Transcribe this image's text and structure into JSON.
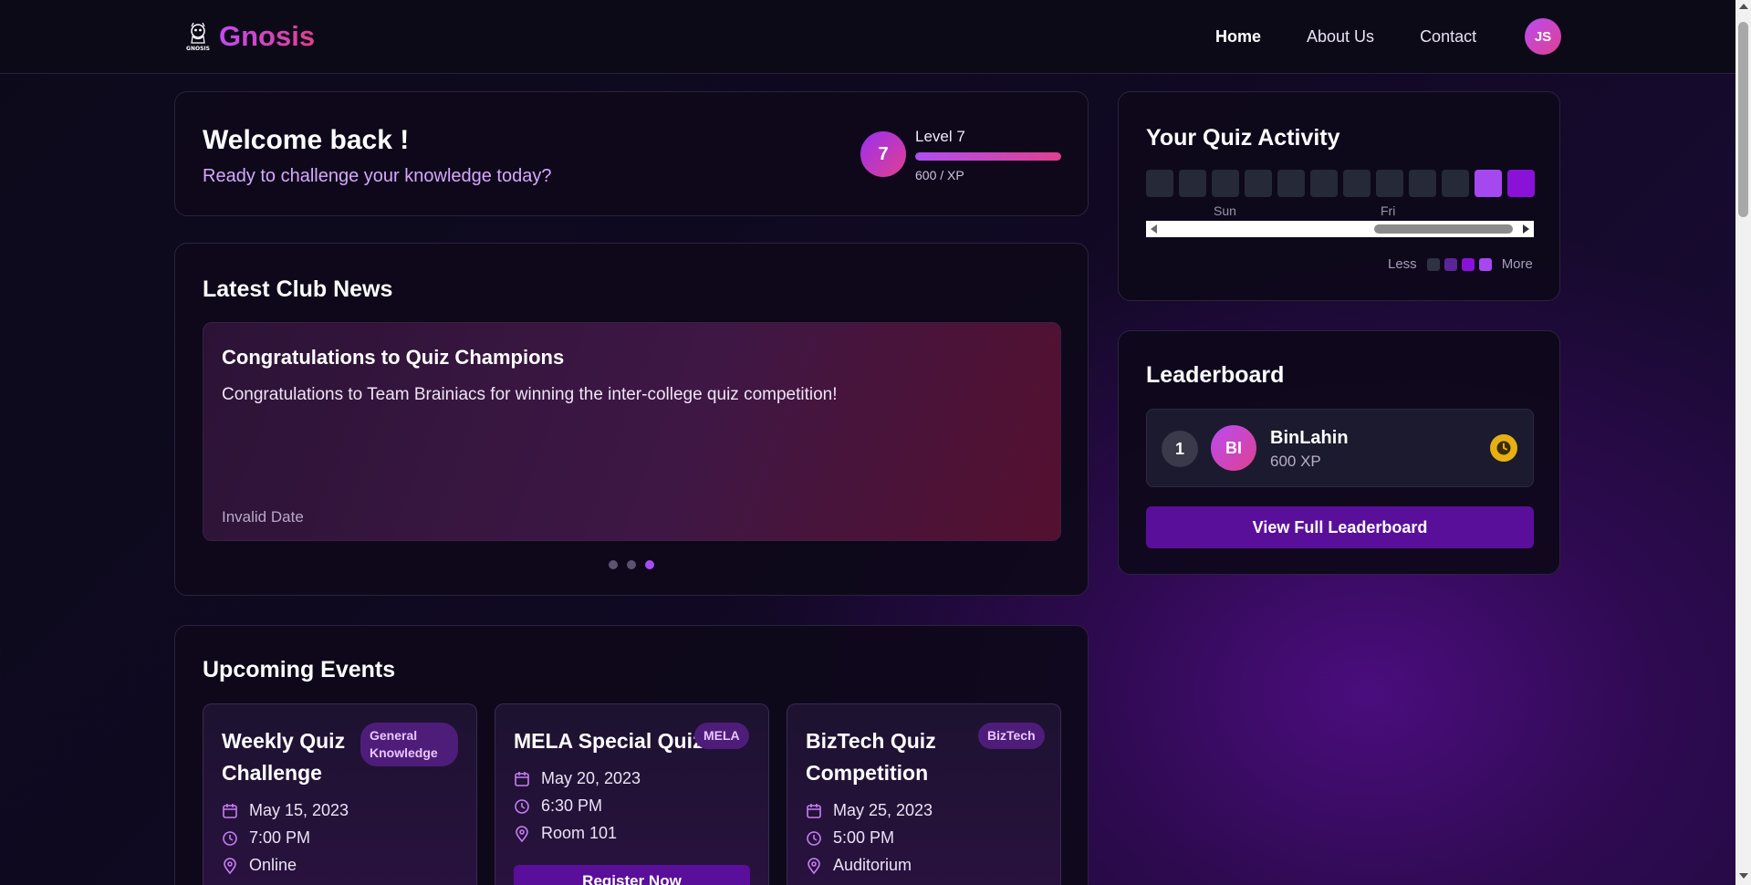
{
  "nav": {
    "brand": "Gnosis",
    "logo_text": "GNOSIS",
    "links": [
      "Home",
      "About Us",
      "Contact"
    ],
    "user_initials": "JS"
  },
  "welcome": {
    "title": "Welcome back !",
    "subtitle": "Ready to challenge your knowledge today?",
    "level_number": "7",
    "level_label": "Level 7",
    "xp_text": "600 / XP",
    "progress_fraction": 1.0
  },
  "news": {
    "title": "Latest Club News",
    "item": {
      "headline": "Congratulations to Quiz Champions",
      "body": "Congratulations to Team Brainiacs for winning the inter-college quiz competition!",
      "date": "Invalid Date"
    },
    "slide_count": 3,
    "active_slide": 3
  },
  "events": {
    "title": "Upcoming Events",
    "register_label": "Register Now",
    "items": [
      {
        "title": "Weekly Quiz Challenge",
        "tag": "General Knowledge",
        "date": "May 15, 2023",
        "time": "7:00 PM",
        "location": "Online"
      },
      {
        "title": "MELA Special Quiz",
        "tag": "MELA",
        "date": "May 20, 2023",
        "time": "6:30 PM",
        "location": "Room 101"
      },
      {
        "title": "BizTech Quiz Competition",
        "tag": "BizTech",
        "date": "May 25, 2023",
        "time": "5:00 PM",
        "location": "Auditorium"
      }
    ]
  },
  "activity": {
    "title": "Your Quiz Activity",
    "day_labels": [
      "Sun",
      "Fri"
    ],
    "cells": [
      0,
      0,
      0,
      0,
      0,
      0,
      0,
      0,
      0,
      0,
      3,
      4
    ],
    "legend_less": "Less",
    "legend_more": "More",
    "colors": {
      "level0": "#252938",
      "level1": "#3b2a5a",
      "level2": "#6b2bb0",
      "level3": "#a648f0",
      "level4": "#8a12d8"
    }
  },
  "leaderboard": {
    "title": "Leaderboard",
    "entries": [
      {
        "rank": "1",
        "initials": "BI",
        "name": "BinLahin",
        "xp": "600 XP",
        "badge_icon": "clock-icon"
      }
    ],
    "button_label": "View Full Leaderboard"
  }
}
